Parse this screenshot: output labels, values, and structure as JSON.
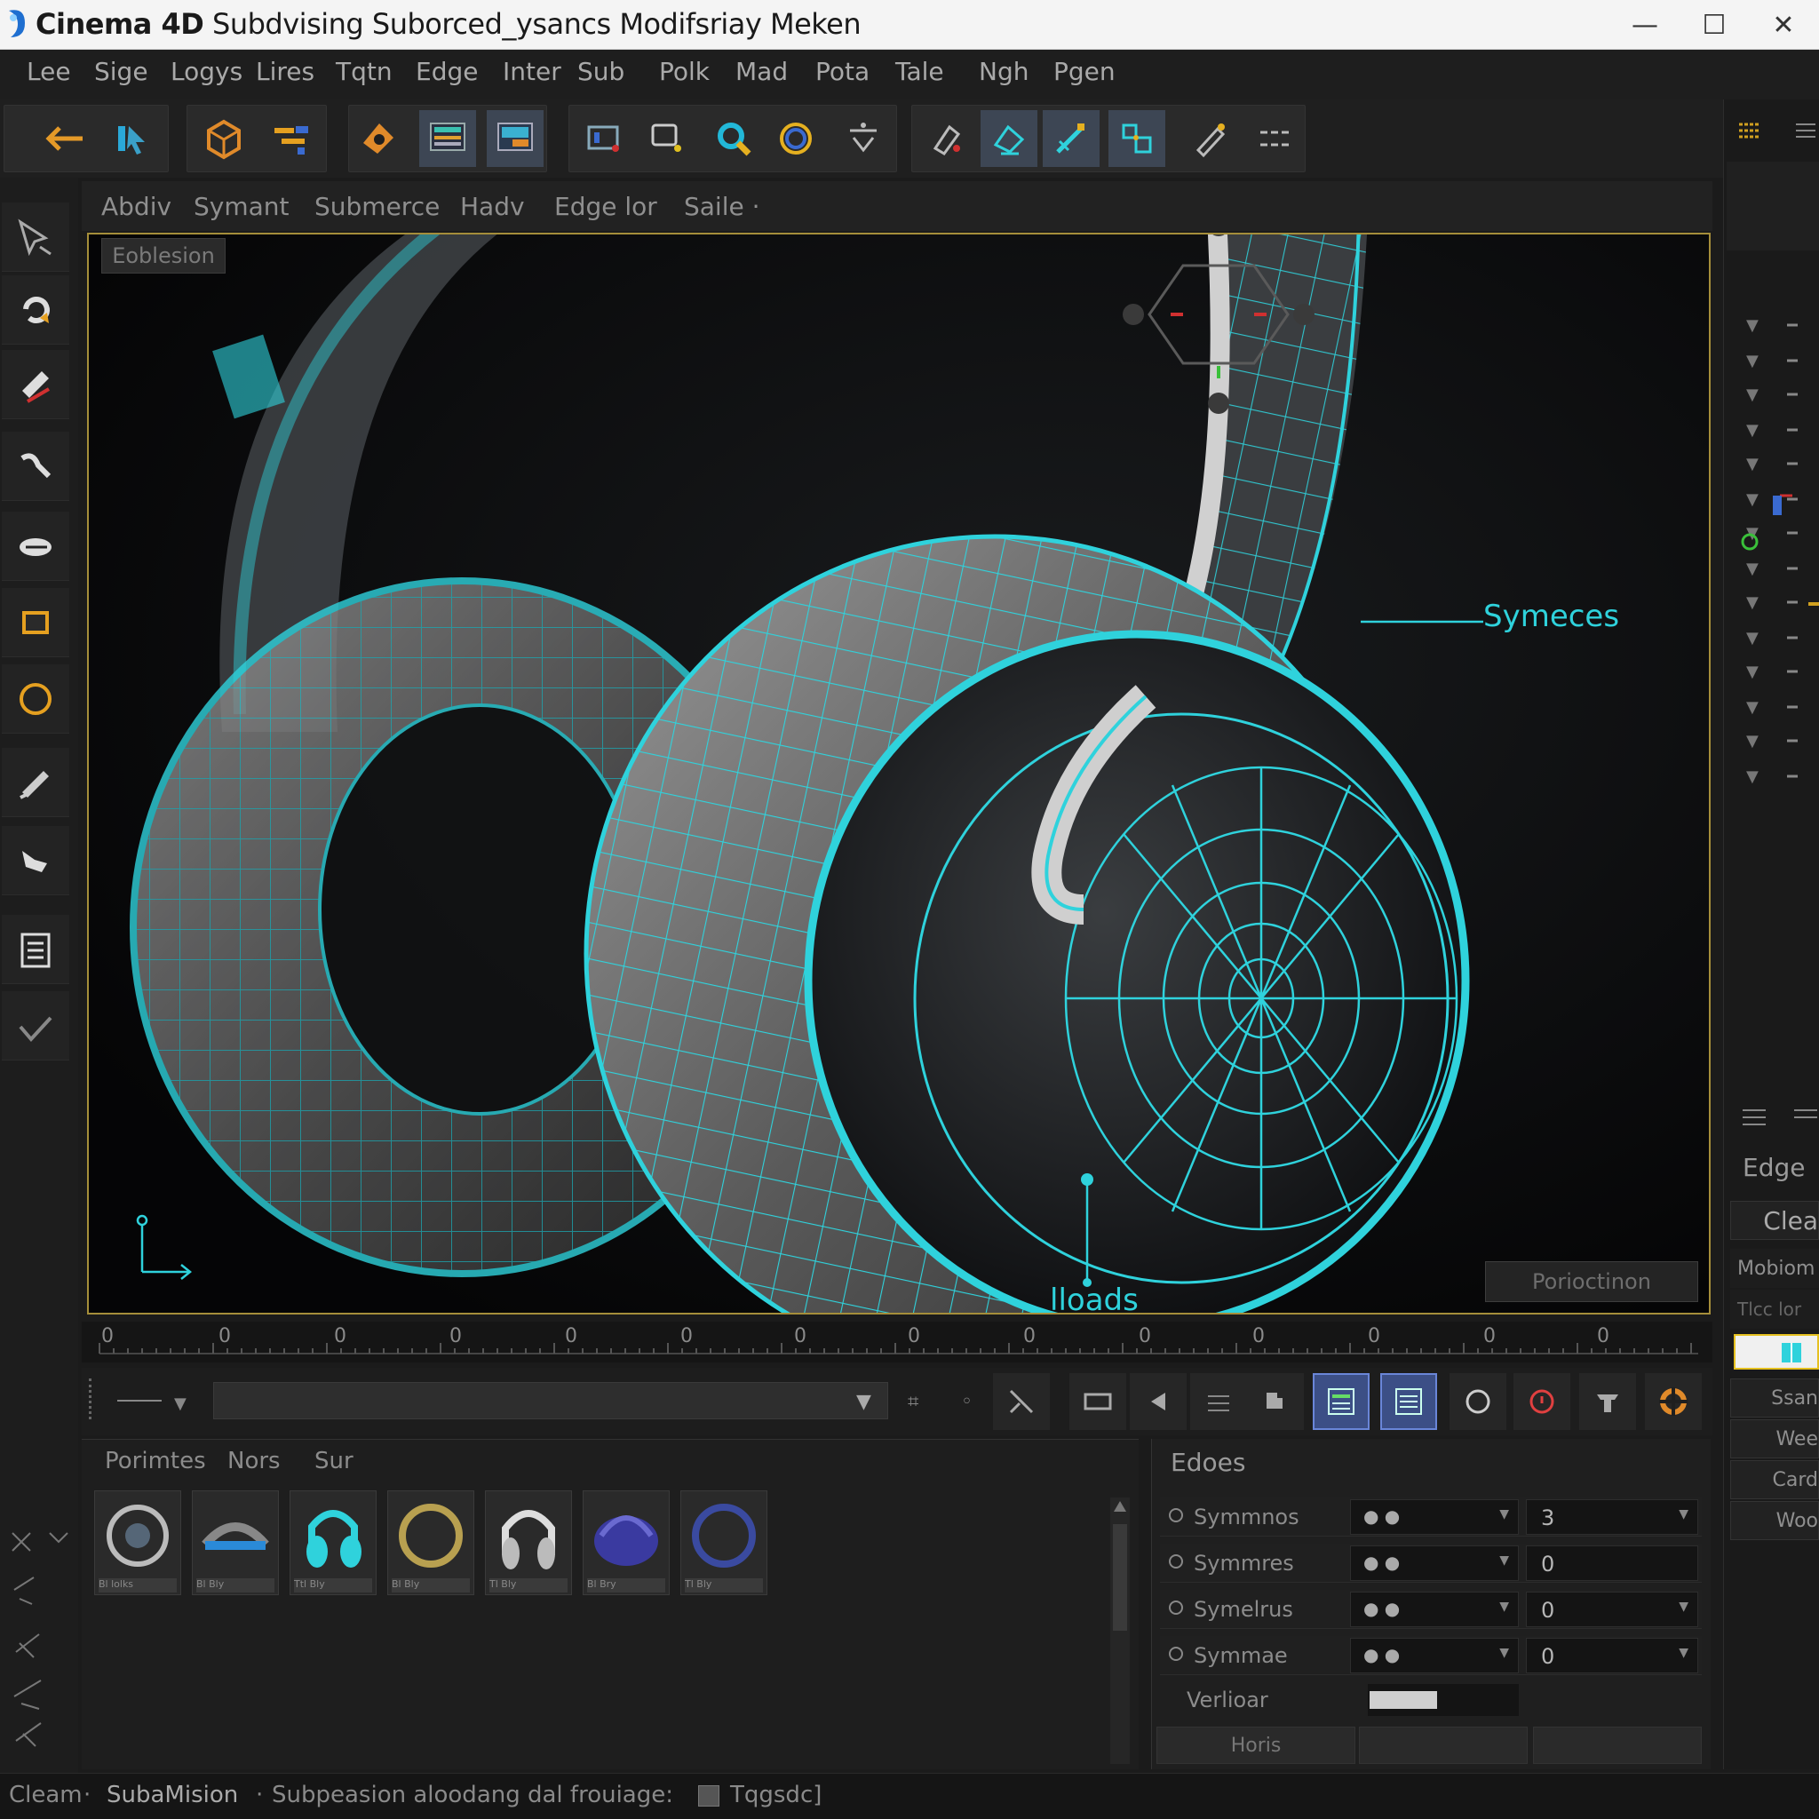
{
  "window": {
    "title_bold": "Cinema 4D",
    "title_rest": "Subdvising Suborced_ysancs Modifsriay Meken",
    "min": "—",
    "max": "☐",
    "close": "✕"
  },
  "menu": [
    "Lee",
    "Sige",
    "Logys",
    "Lires",
    "Tqtn",
    "Edge",
    "Inter",
    "Sub",
    "Polk",
    "Mad",
    "Pota",
    "Tale",
    "Ngh",
    "Pgen"
  ],
  "viewport_menu": [
    "Abdiv",
    "Symant",
    "Submerce",
    "Hadv",
    "Edge lor",
    "Saile ·"
  ],
  "viewport": {
    "camera_label": "Eoblesion",
    "callout_right": "Symeces",
    "callout_bottom": "lloads",
    "projection_button": "Porioctinon"
  },
  "timeline_ticks": [
    "0",
    "0",
    "0",
    "0",
    "0",
    "0",
    "0",
    "0",
    "0",
    "0",
    "0",
    "0",
    "0",
    "0"
  ],
  "assets": {
    "tabs": [
      "Porimtes",
      "Nors",
      "Sur"
    ],
    "thumbs": [
      "Bl lolks",
      "Bl Bly",
      "Ttl Bly",
      "Bl Bly",
      "Tl Bly",
      "Bl Bry",
      "Tl Bly"
    ]
  },
  "attributes": {
    "title": "Edoes",
    "rows": [
      {
        "name": "Symmnos",
        "value": "3"
      },
      {
        "name": "Symmres",
        "value": "0"
      },
      {
        "name": "Symelrus",
        "value": "0"
      },
      {
        "name": "Symmae",
        "value": "0"
      }
    ],
    "verlier_label": "Verlioar",
    "footer_label": "Horis"
  },
  "right_panel": {
    "edge_label": "Edge",
    "clear_label": "Clea",
    "mobiom_label": "Mobiom",
    "items": [
      "Tlcc lor",
      "Ssan",
      "Wee",
      "Card",
      "Woo"
    ]
  },
  "status": {
    "left": "Cleam",
    "mid": "SubaMision",
    "msg": "Subpeasion aloodang dal frouiage:",
    "tag": "Tqgsdc]"
  },
  "colors": {
    "accent_cyan": "#2fd2dc",
    "viewport_border": "#a58e3a",
    "active_button": "#3c4f86"
  }
}
